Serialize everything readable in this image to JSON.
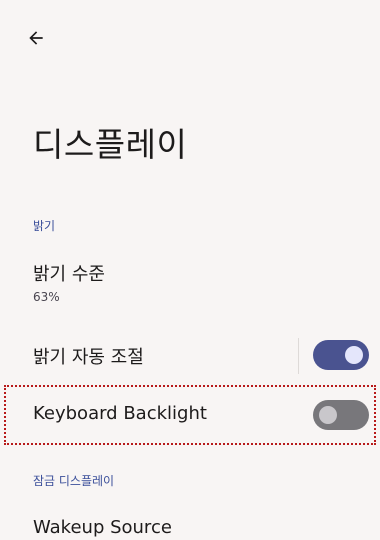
{
  "header": {
    "back_icon": "arrow-left-icon",
    "title": "디스플레이"
  },
  "sections": {
    "brightness": {
      "header": "밝기",
      "brightness_level": {
        "title": "밝기 수준",
        "summary": "63%"
      },
      "adaptive_brightness": {
        "title": "밝기 자동 조절",
        "checked": true
      },
      "keyboard_backlight": {
        "title": "Keyboard Backlight",
        "checked": false
      }
    },
    "lock_display": {
      "header": "잠금 디스플레이",
      "wakeup_source": {
        "title": "Wakeup Source"
      }
    }
  },
  "colors": {
    "background": "#f8f5f4",
    "accent": "#3b4f9a",
    "switch_on_track": "#4a5390",
    "switch_off_track": "#78777b",
    "highlight": "#b81a1a"
  }
}
